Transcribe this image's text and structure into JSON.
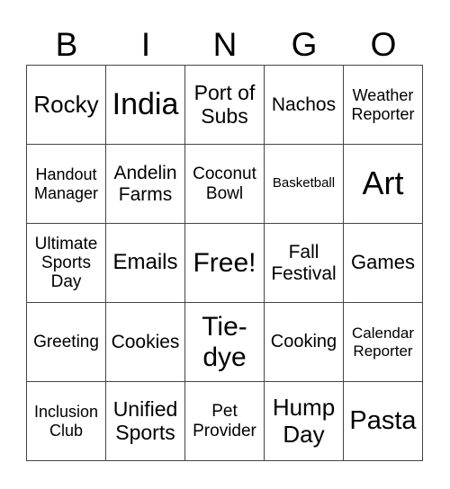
{
  "header": [
    "B",
    "I",
    "N",
    "G",
    "O"
  ],
  "cells": [
    "Rocky",
    "India",
    "Port of Subs",
    "Nachos",
    "Weather Reporter",
    "Handout Manager",
    "Andelin Farms",
    "Coconut Bowl",
    "Basketball",
    "Art",
    "Ultimate Sports Day",
    "Emails",
    "Free!",
    "Fall Festival",
    "Games",
    "Greeting",
    "Cookies",
    "Tie-dye",
    "Cooking",
    "Calendar Reporter",
    "Inclusion Club",
    "Unified Sports",
    "Pet Provider",
    "Hump Day",
    "Pasta"
  ]
}
